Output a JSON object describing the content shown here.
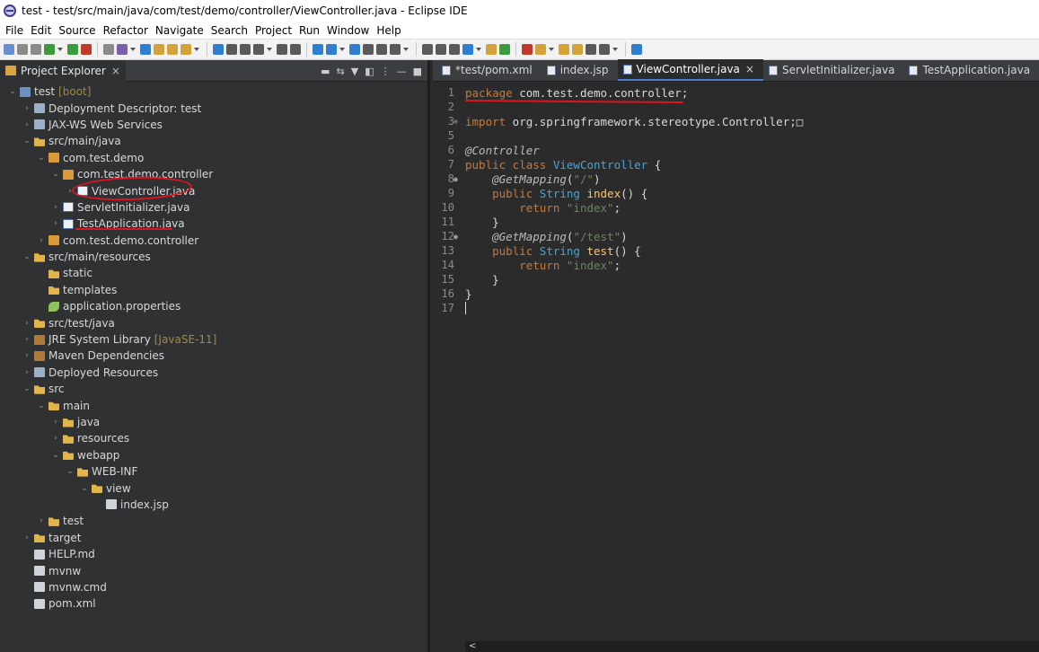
{
  "window": {
    "title": "test - test/src/main/java/com/test/demo/controller/ViewController.java - Eclipse IDE"
  },
  "menu": [
    "File",
    "Edit",
    "Source",
    "Refactor",
    "Navigate",
    "Search",
    "Project",
    "Run",
    "Window",
    "Help"
  ],
  "explorer": {
    "tab_label": "Project Explorer",
    "close_glyph": "×",
    "tree": [
      {
        "label": "test",
        "decor": "[boot]",
        "depth": 0,
        "icon": "project",
        "open": true
      },
      {
        "label": "Deployment Descriptor: test",
        "depth": 1,
        "icon": "web",
        "open": false
      },
      {
        "label": "JAX-WS Web Services",
        "depth": 1,
        "icon": "web",
        "open": false
      },
      {
        "label": "src/main/java",
        "depth": 1,
        "icon": "folder",
        "open": true
      },
      {
        "label": "com.test.demo",
        "depth": 2,
        "icon": "pkg",
        "open": true
      },
      {
        "label": "com.test.demo.controller",
        "depth": 3,
        "icon": "pkg",
        "open": true
      },
      {
        "label": "ViewController.java",
        "depth": 4,
        "icon": "java",
        "open": false
      },
      {
        "label": "ServletInitializer.java",
        "depth": 3,
        "icon": "java",
        "open": false
      },
      {
        "label": "TestApplication.java",
        "depth": 3,
        "icon": "java",
        "open": false
      },
      {
        "label": "com.test.demo.controller",
        "depth": 2,
        "icon": "pkg",
        "open": false
      },
      {
        "label": "src/main/resources",
        "depth": 1,
        "icon": "folder",
        "open": true
      },
      {
        "label": "static",
        "depth": 2,
        "icon": "folder",
        "leaf": true
      },
      {
        "label": "templates",
        "depth": 2,
        "icon": "folder",
        "leaf": true
      },
      {
        "label": "application.properties",
        "depth": 2,
        "icon": "props",
        "leaf": true
      },
      {
        "label": "src/test/java",
        "depth": 1,
        "icon": "folder",
        "open": false
      },
      {
        "label": "JRE System Library",
        "decor": "[JavaSE-11]",
        "depth": 1,
        "icon": "lib",
        "open": false
      },
      {
        "label": "Maven Dependencies",
        "depth": 1,
        "icon": "lib",
        "open": false
      },
      {
        "label": "Deployed Resources",
        "depth": 1,
        "icon": "web",
        "open": false
      },
      {
        "label": "src",
        "depth": 1,
        "icon": "folder",
        "open": true
      },
      {
        "label": "main",
        "depth": 2,
        "icon": "folder",
        "open": true
      },
      {
        "label": "java",
        "depth": 3,
        "icon": "folder",
        "open": false
      },
      {
        "label": "resources",
        "depth": 3,
        "icon": "folder",
        "open": false
      },
      {
        "label": "webapp",
        "depth": 3,
        "icon": "folder",
        "open": true
      },
      {
        "label": "WEB-INF",
        "depth": 4,
        "icon": "folder",
        "open": true
      },
      {
        "label": "view",
        "depth": 5,
        "icon": "folder",
        "open": true
      },
      {
        "label": "index.jsp",
        "depth": 6,
        "icon": "file",
        "leaf": true
      },
      {
        "label": "test",
        "depth": 2,
        "icon": "folder",
        "open": false
      },
      {
        "label": "target",
        "depth": 1,
        "icon": "folder",
        "open": false
      },
      {
        "label": "HELP.md",
        "depth": 1,
        "icon": "file",
        "leaf": true
      },
      {
        "label": "mvnw",
        "depth": 1,
        "icon": "file",
        "leaf": true
      },
      {
        "label": "mvnw.cmd",
        "depth": 1,
        "icon": "file",
        "leaf": true
      },
      {
        "label": "pom.xml",
        "depth": 1,
        "icon": "file",
        "leaf": true
      }
    ]
  },
  "editor": {
    "tabs": [
      {
        "label": "*test/pom.xml",
        "active": false
      },
      {
        "label": "index.jsp",
        "active": false
      },
      {
        "label": "ViewController.java",
        "active": true
      },
      {
        "label": "ServletInitializer.java",
        "active": false
      },
      {
        "label": "TestApplication.java",
        "active": false
      }
    ],
    "close_glyph": "×",
    "lines": [
      {
        "n": "1",
        "tokens": [
          [
            "kw",
            "package"
          ],
          [
            "t",
            " com.test.demo.controller;"
          ]
        ]
      },
      {
        "n": "2",
        "tokens": []
      },
      {
        "n": "3",
        "mark": "⊕",
        "tokens": [
          [
            "kw",
            "import"
          ],
          [
            "t",
            " org.springframework.stereotype.Controller;"
          ],
          [
            "t",
            "□"
          ]
        ]
      },
      {
        "n": "5",
        "tokens": []
      },
      {
        "n": "6",
        "tokens": [
          [
            "ann",
            "@Controller"
          ]
        ]
      },
      {
        "n": "7",
        "tokens": [
          [
            "kw",
            "public class"
          ],
          [
            "t",
            " "
          ],
          [
            "type",
            "ViewController"
          ],
          [
            "t",
            " {"
          ]
        ]
      },
      {
        "n": "8",
        "mark": "●",
        "tokens": [
          [
            "t",
            "    "
          ],
          [
            "ann",
            "@GetMapping"
          ],
          [
            "t",
            "("
          ],
          [
            "str",
            "\"/\""
          ],
          [
            "t",
            ")"
          ]
        ]
      },
      {
        "n": "9",
        "tokens": [
          [
            "t",
            "    "
          ],
          [
            "kw",
            "public"
          ],
          [
            "t",
            " "
          ],
          [
            "type",
            "String"
          ],
          [
            "t",
            " "
          ],
          [
            "method",
            "index"
          ],
          [
            "t",
            "() {"
          ]
        ]
      },
      {
        "n": "10",
        "tokens": [
          [
            "t",
            "        "
          ],
          [
            "kw",
            "return"
          ],
          [
            "t",
            " "
          ],
          [
            "str",
            "\"index\""
          ],
          [
            "t",
            ";"
          ]
        ]
      },
      {
        "n": "11",
        "tokens": [
          [
            "t",
            "    }"
          ]
        ]
      },
      {
        "n": "12",
        "mark": "●",
        "tokens": [
          [
            "t",
            "    "
          ],
          [
            "ann",
            "@GetMapping"
          ],
          [
            "t",
            "("
          ],
          [
            "str",
            "\"/test\""
          ],
          [
            "t",
            ")"
          ]
        ]
      },
      {
        "n": "13",
        "tokens": [
          [
            "t",
            "    "
          ],
          [
            "kw",
            "public"
          ],
          [
            "t",
            " "
          ],
          [
            "type",
            "String"
          ],
          [
            "t",
            " "
          ],
          [
            "method",
            "test"
          ],
          [
            "t",
            "() {"
          ]
        ]
      },
      {
        "n": "14",
        "tokens": [
          [
            "t",
            "        "
          ],
          [
            "kw",
            "return"
          ],
          [
            "t",
            " "
          ],
          [
            "str",
            "\"index\""
          ],
          [
            "t",
            ";"
          ]
        ]
      },
      {
        "n": "15",
        "tokens": [
          [
            "t",
            "    }"
          ]
        ]
      },
      {
        "n": "16",
        "tokens": [
          [
            "t",
            "}"
          ]
        ]
      },
      {
        "n": "17",
        "tokens": [],
        "cursor": true
      }
    ],
    "hscroll_glyph": "<"
  }
}
